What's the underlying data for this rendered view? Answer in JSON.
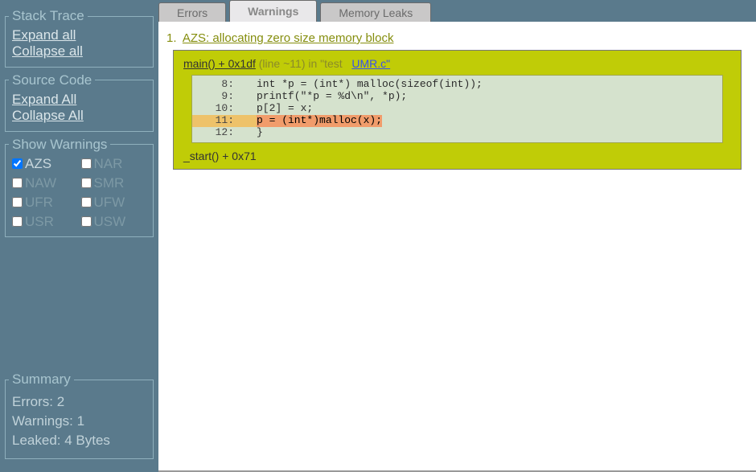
{
  "sidebar": {
    "stackTrace": {
      "legend": "Stack Trace",
      "expand": "Expand all",
      "collapse": "Collapse all"
    },
    "sourceCode": {
      "legend": "Source Code",
      "expand": "Expand All",
      "collapse": "Collapse All"
    },
    "showWarnings": {
      "legend": "Show Warnings",
      "items": [
        {
          "code": "AZS",
          "checked": true,
          "active": true
        },
        {
          "code": "NAR",
          "checked": false,
          "active": false
        },
        {
          "code": "NAW",
          "checked": false,
          "active": false
        },
        {
          "code": "SMR",
          "checked": false,
          "active": false
        },
        {
          "code": "UFR",
          "checked": false,
          "active": false
        },
        {
          "code": "UFW",
          "checked": false,
          "active": false
        },
        {
          "code": "USR",
          "checked": false,
          "active": false
        },
        {
          "code": "USW",
          "checked": false,
          "active": false
        }
      ]
    },
    "summary": {
      "legend": "Summary",
      "errors": "Errors: 2",
      "warnings": "Warnings: 1",
      "leaked": "Leaked: 4 Bytes"
    }
  },
  "tabs": {
    "errors": "Errors",
    "warnings": "Warnings",
    "memleaks": "Memory Leaks"
  },
  "warning": {
    "num": "1.",
    "title": "AZS: allocating zero size memory block",
    "func": "main() + 0x1df",
    "lineinfo": "(line ~11) in \"test",
    "file": "UMR.c\"",
    "code": [
      {
        "ln": "8:",
        "src": "int *p = (int*) malloc(sizeof(int));",
        "hl": false
      },
      {
        "ln": "9:",
        "src": "printf(\"*p = %d\\n\", *p);",
        "hl": false
      },
      {
        "ln": "10:",
        "src": "p[2] = x;",
        "hl": false
      },
      {
        "ln": "11:",
        "src": "p = (int*)malloc(x);",
        "hl": true
      },
      {
        "ln": "12:",
        "src": "}",
        "hl": false
      }
    ],
    "trail": "_start() + 0x71"
  }
}
